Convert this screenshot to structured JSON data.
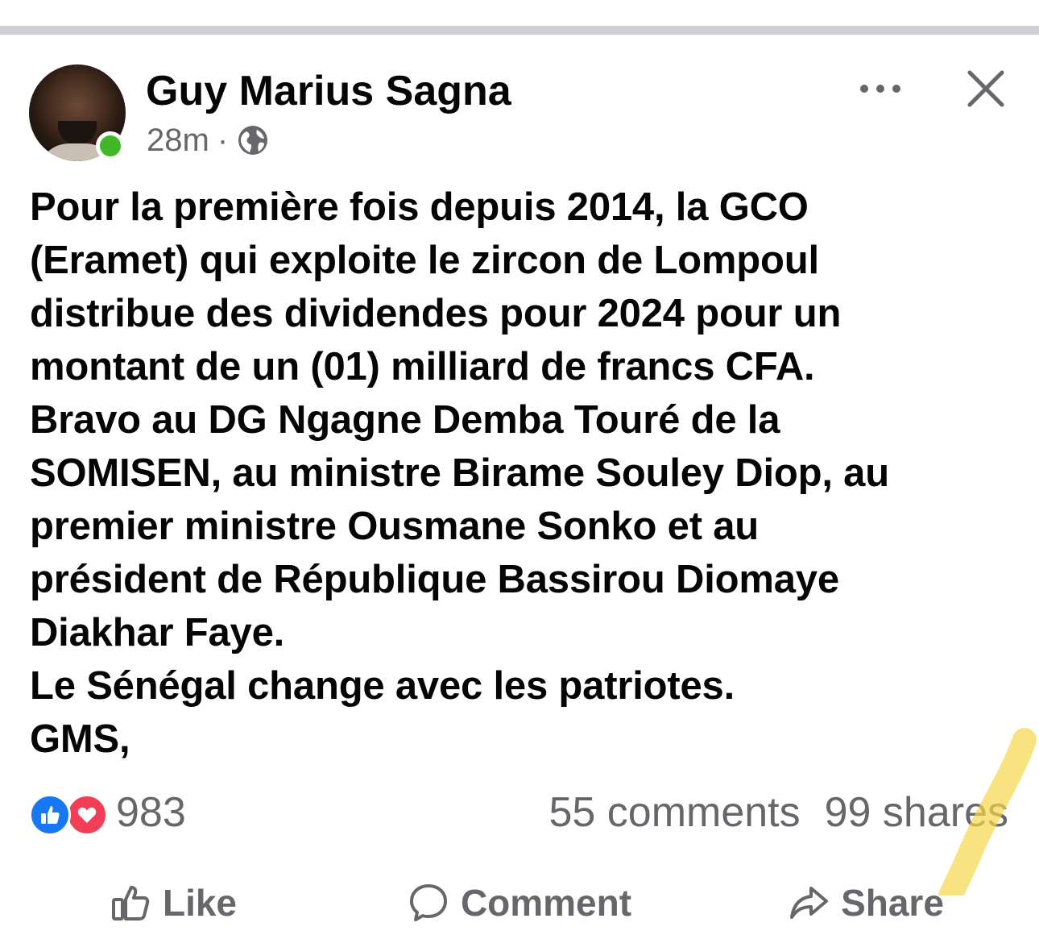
{
  "post": {
    "author": "Guy Marius Sagna",
    "time": "28m",
    "separator": "·",
    "audience_icon": "globe-icon",
    "lines": [
      "Pour la première fois depuis 2014, la GCO",
      "(Eramet) qui exploite le zircon de Lompoul",
      "distribue des dividendes pour 2024 pour un",
      "montant de un (01) milliard de francs CFA.",
      "Bravo au DG Ngagne Demba Touré de la",
      "SOMISEN, au ministre Birame Souley Diop, au",
      "premier ministre Ousmane Sonko et au",
      "président de République Bassirou Diomaye",
      "Diakhar Faye.",
      "Le Sénégal change avec les patriotes.",
      "GMS,"
    ]
  },
  "header_icons": {
    "more": "more-options-icon",
    "close": "close-icon"
  },
  "engagement": {
    "reaction_icons": [
      "like-reaction-icon",
      "love-reaction-icon"
    ],
    "reaction_count": "983",
    "comments": "55 comments",
    "shares": "99 shares"
  },
  "actions": {
    "like": "Like",
    "comment": "Comment",
    "share": "Share"
  },
  "colors": {
    "like_blue": "#1877f2",
    "love_red": "#f33e58",
    "online_green": "#42b72a",
    "secondary_text": "#65676b",
    "highlighter": "#f7d64a"
  }
}
